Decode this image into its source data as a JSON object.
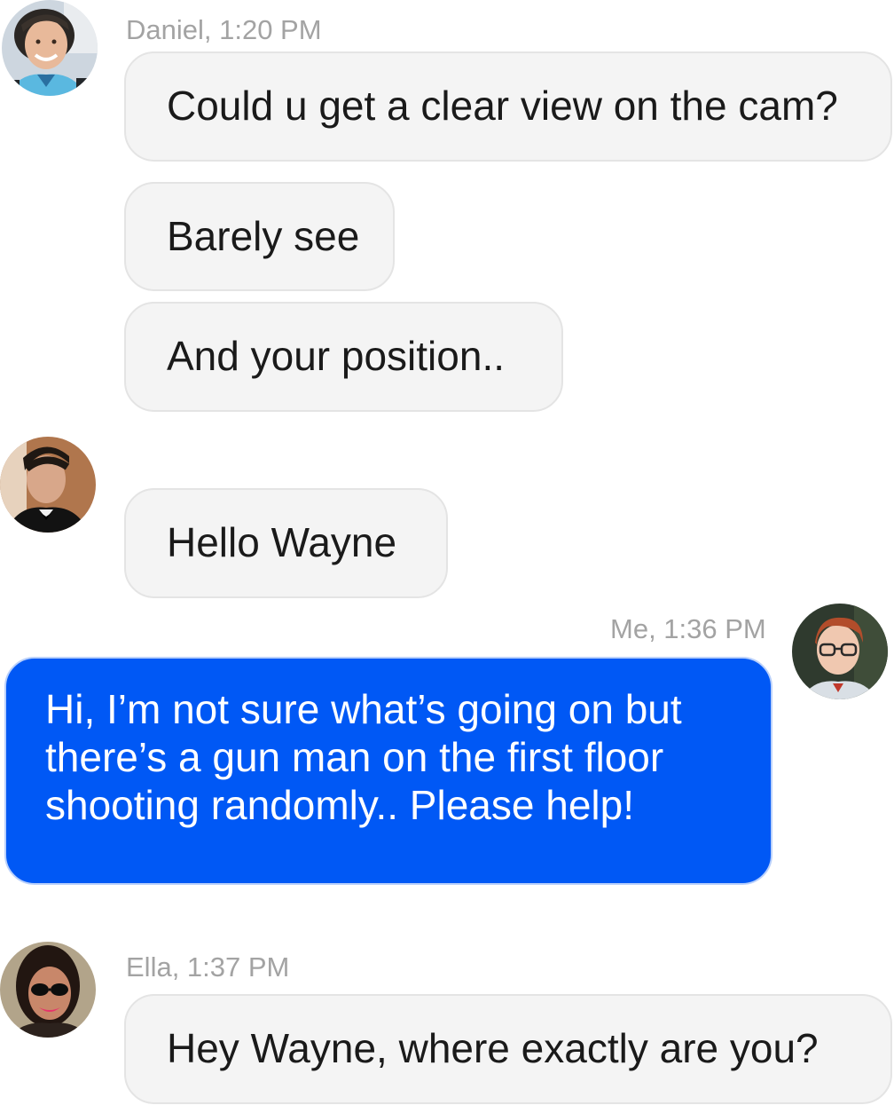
{
  "messages": [
    {
      "sender": "Daniel",
      "time": "1:20 PM",
      "header": "Daniel, 1:20 PM",
      "avatar_icon": "daniel-avatar",
      "texts": [
        "Could u get a clear view on the cam?",
        "Barely see",
        "And your position.."
      ]
    },
    {
      "avatar_icon": "unnamed-contact-avatar",
      "texts": [
        "Hello Wayne"
      ]
    },
    {
      "sender": "Me",
      "time": "1:36 PM",
      "header": "Me, 1:36 PM",
      "avatar_icon": "me-avatar",
      "texts": [
        "Hi, I’m not sure what’s going on but there’s a gun man on the first floor shooting randomly.. Please help!"
      ]
    },
    {
      "sender": "Ella",
      "time": "1:37 PM",
      "header": "Ella, 1:37 PM",
      "avatar_icon": "ella-avatar",
      "texts": [
        "Hey Wayne, where exactly are you?"
      ]
    }
  ],
  "colors": {
    "my_bubble": "#0058f5",
    "other_bubble": "#f4f4f4",
    "meta_text": "#a3a3a3"
  }
}
